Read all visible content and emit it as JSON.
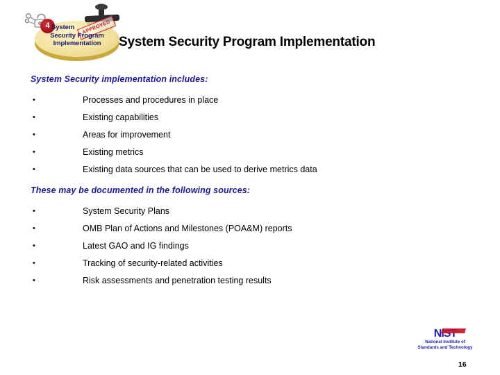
{
  "slide": {
    "title": "System Security Program Implementation",
    "page_number": "16",
    "background_color": "#ffffff"
  },
  "badge": {
    "step_number": "4",
    "line1": "System",
    "line2": "Security Program",
    "line3": "Implementation",
    "stamp_label": "APPROVED",
    "ellipse_color": "#f3e3a0",
    "step_circle_color": "#a8131e",
    "stamp_color": "#d01020",
    "text_color": "#1b1b6e",
    "padlock_icon": "padlock-icon"
  },
  "sections": [
    {
      "heading": "System Security implementation includes:",
      "heading_color": "#1a1a8e",
      "bullet_marker": "•",
      "items": [
        "Processes and procedures in place",
        "Existing capabilities",
        "Areas for improvement",
        "Existing metrics",
        "Existing data sources that can be used to derive metrics data"
      ]
    },
    {
      "heading": "These may be documented in the following sources:",
      "heading_color": "#1a1a8e",
      "bullet_marker": "•",
      "items": [
        "System Security Plans",
        "OMB Plan of Actions and Milestones (POA&M) reports",
        "Latest GAO and IG findings",
        "Tracking of security-related activities",
        "Risk assessments and penetration testing results"
      ]
    }
  ],
  "nist_logo": {
    "wordmark": "NIST",
    "tagline_line1": "National Institute of",
    "tagline_line2": "Standards and Technology",
    "blue": "#2222aa",
    "red": "#c0172a"
  }
}
